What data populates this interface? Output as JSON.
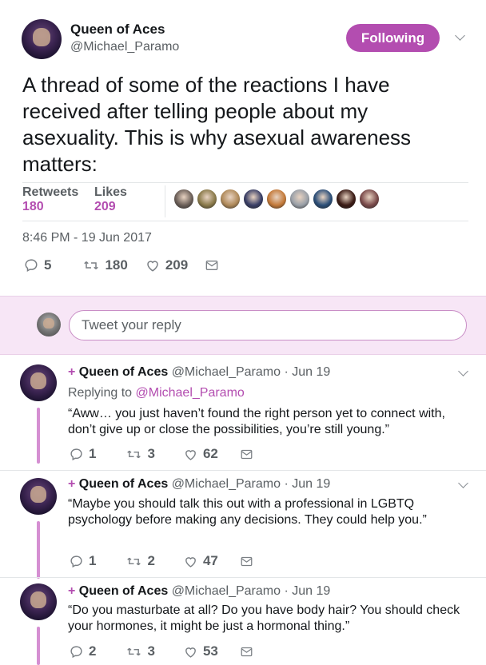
{
  "tweet": {
    "name": "Queen of Aces",
    "handle": "@Michael_Paramo",
    "follow_label": "Following",
    "text": "A thread of some of the reactions I have received after telling people about my asexuality. This is why asexual awareness matters:",
    "retweets_label": "Retweets",
    "retweets": "180",
    "likes_label": "Likes",
    "likes": "209",
    "timestamp": "8:46 PM - 19 Jun 2017",
    "actions": {
      "replies": "5",
      "retweets": "180",
      "likes": "209"
    }
  },
  "likers": [
    "#6b5f58",
    "#8a7a4a",
    "#b08a5a",
    "#3a3f66",
    "#c47a3a",
    "#9aa0a8",
    "#2b4e78",
    "#3a1a14",
    "#7a4a4a"
  ],
  "reply_box": {
    "placeholder": "Tweet your reply"
  },
  "replies": [
    {
      "plus": "+",
      "name": "Queen of Aces",
      "handle": "@Michael_Paramo",
      "date": "· Jun 19",
      "replying_prefix": "Replying to",
      "replying_to": "@Michael_Paramo",
      "text": "“Aww… you just haven’t found the right person yet to connect with, don’t give up or close the possibilities, you’re still young.”",
      "replies": "1",
      "retweets": "3",
      "likes": "62"
    },
    {
      "plus": "+",
      "name": "Queen of Aces",
      "handle": "@Michael_Paramo",
      "date": "· Jun 19",
      "text": "“Maybe you should talk this out with a professional in LGBTQ psychology before making any decisions. They could help you.”",
      "replies": "1",
      "retweets": "2",
      "likes": "47"
    },
    {
      "plus": "+",
      "name": "Queen of Aces",
      "handle": "@Michael_Paramo",
      "date": "· Jun 19",
      "text": "“Do you masturbate at all? Do you have body hair? You should check your hormones, it might be just a hormonal thing.”",
      "replies": "2",
      "retweets": "3",
      "likes": "53"
    }
  ],
  "colors": {
    "accent": "#b34db0",
    "thread_line": "#d58fd2",
    "reply_bar": "#f7e6f6",
    "text_secondary": "#5a5f63"
  },
  "icons": [
    "reply-icon",
    "retweet-icon",
    "heart-icon",
    "message-icon",
    "chevron-down-icon"
  ]
}
